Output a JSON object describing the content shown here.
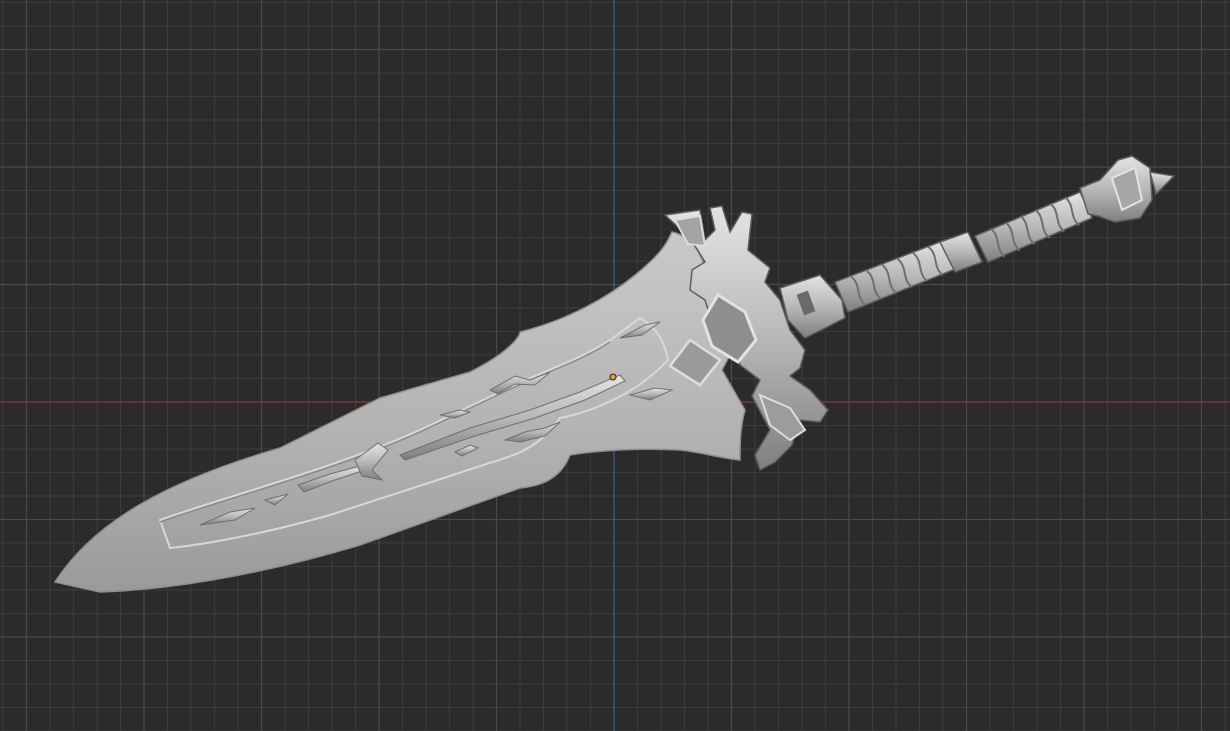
{
  "viewport": {
    "background": "#2b2b2b",
    "grid_minor_color": "#3c3c3c",
    "grid_major_color": "#4a4a4a",
    "axis_x_color": "#8a3a3a",
    "axis_y_color": "#3d5f9e"
  },
  "object": {
    "type": "sword-mesh",
    "material_color": "#b9bab8",
    "shadow_color": "#8e8f8d",
    "highlight_color": "#dcdcda",
    "origin_color": "#e0a020"
  }
}
